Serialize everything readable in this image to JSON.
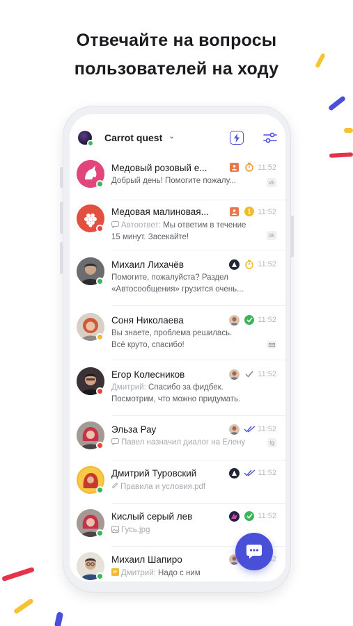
{
  "headline": {
    "line1": "Отвечайте на вопросы",
    "line2": "пользователей на ходу"
  },
  "topbar": {
    "workspace": "Carrot quest",
    "icons": [
      "chevron-down-icon",
      "lightning-icon",
      "filter-sliders-icon"
    ]
  },
  "colors": {
    "accent": "#4a4fd8",
    "online": "#3bb559",
    "away": "#f5b82e",
    "busy": "#e5473c"
  },
  "conversations": [
    {
      "name": "Медовый розовый е...",
      "time": "11:52",
      "prefix": "",
      "preview": "Добрый день! Помогите пожалу...",
      "channel": "vk",
      "assignee": "orange-user-badge",
      "state": "timer",
      "status": "online"
    },
    {
      "name": "Медовая малиновая...",
      "time": "11:52",
      "prefix": "Автоответ:",
      "preview": "Мы ответим в течение 15 минут. Засекайте!",
      "channel": "ok",
      "assignee": "orange-user-badge",
      "state": "1",
      "status": "busy"
    },
    {
      "name": "Михаил Лихачёв",
      "time": "11:52",
      "prefix": "",
      "preview": "Помогите, пожалуйста? Раздел «Автосообщения» грузится очень...",
      "channel": "",
      "assignee": "operator-avatar",
      "state": "timer",
      "status": "online"
    },
    {
      "name": "Соня Николаева",
      "time": "11:52",
      "prefix": "",
      "preview": "Вы знаете, проблема решилась. Всё круто, спасибо!",
      "channel": "email",
      "assignee": "operator-avatar",
      "state": "resolved",
      "status": "away"
    },
    {
      "name": "Егор Колесников",
      "time": "11:52",
      "prefix": "Дмитрий:",
      "preview": "Спасибо за фидбек. Посмотрим, что можно придумать.",
      "channel": "",
      "assignee": "operator-avatar",
      "state": "sent",
      "status": "busy"
    },
    {
      "name": "Эльза Рау",
      "time": "11:52",
      "prefix": "",
      "preview": "Павел назначил диалог на Елену",
      "channel": "tg",
      "assignee": "operator-avatar",
      "state": "read",
      "status": "busy"
    },
    {
      "name": "Дмитрий Туровский",
      "time": "11:52",
      "prefix": "",
      "preview": "Правила и условия.pdf",
      "channel": "",
      "assignee": "operator-avatar",
      "state": "read",
      "status": "online"
    },
    {
      "name": "Кислый серый лев",
      "time": "11:52",
      "prefix": "",
      "preview": "Гусь.jpg",
      "channel": "",
      "assignee": "operator-avatar",
      "state": "resolved",
      "status": "online"
    },
    {
      "name": "Михаил Шапиро",
      "time": "11:52",
      "prefix": "Дмитрий:",
      "preview": "Надо с ним",
      "channel": "",
      "assignee": "operator-avatar",
      "state": "",
      "status": "online"
    }
  ],
  "fab": {
    "icon": "chat-bubble-icon"
  }
}
